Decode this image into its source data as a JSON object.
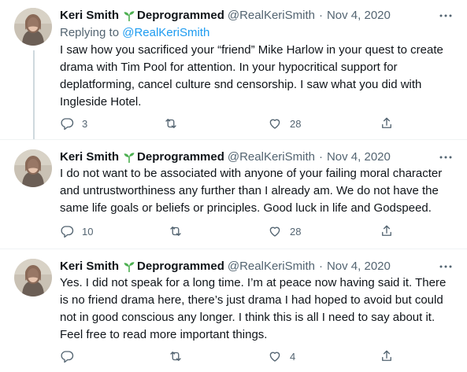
{
  "colors": {
    "text": "#0f1419",
    "secondary": "#536471",
    "link": "#1d9bf0",
    "sprout": "#4caf50",
    "divider": "#eff3f4"
  },
  "tweets": [
    {
      "author_name": "Keri Smith",
      "display_suffix": "Deprogrammed",
      "handle": "@RealKeriSmith",
      "separator": "·",
      "date": "Nov 4, 2020",
      "replying_label": "Replying to",
      "replying_to": "@RealKeriSmith",
      "text": "I saw how you sacrificed your “friend” Mike Harlow in your quest to create drama with Tim Pool for attention. In your hypocritical support for deplatforming, cancel culture snd censorship. I saw what you did with Ingleside Hotel.",
      "replies": "3",
      "retweets": "",
      "likes": "28"
    },
    {
      "author_name": "Keri Smith",
      "display_suffix": "Deprogrammed",
      "handle": "@RealKeriSmith",
      "separator": "·",
      "date": "Nov 4, 2020",
      "text": "I do not want to be associated with anyone of your failing moral character and untrustworthiness any further than I already am. We do not have the same life goals or beliefs or principles. Good luck in life and Godspeed.",
      "replies": "10",
      "retweets": "",
      "likes": "28"
    },
    {
      "author_name": "Keri Smith",
      "display_suffix": "Deprogrammed",
      "handle": "@RealKeriSmith",
      "separator": "·",
      "date": "Nov 4, 2020",
      "text": "Yes. I did not speak for a long time. I’m at peace now having said it. There is no friend drama here, there’s just drama I had hoped to avoid but could not in good conscious any longer. I think this is all I need to say about it. Feel free to read more important things.",
      "replies": "",
      "retweets": "",
      "likes": "4"
    }
  ],
  "icons": {
    "reply": "reply-icon",
    "retweet": "retweet-icon",
    "like": "heart-icon",
    "share": "share-icon",
    "more": "more-dots-icon",
    "sprout": "sprout-icon"
  }
}
